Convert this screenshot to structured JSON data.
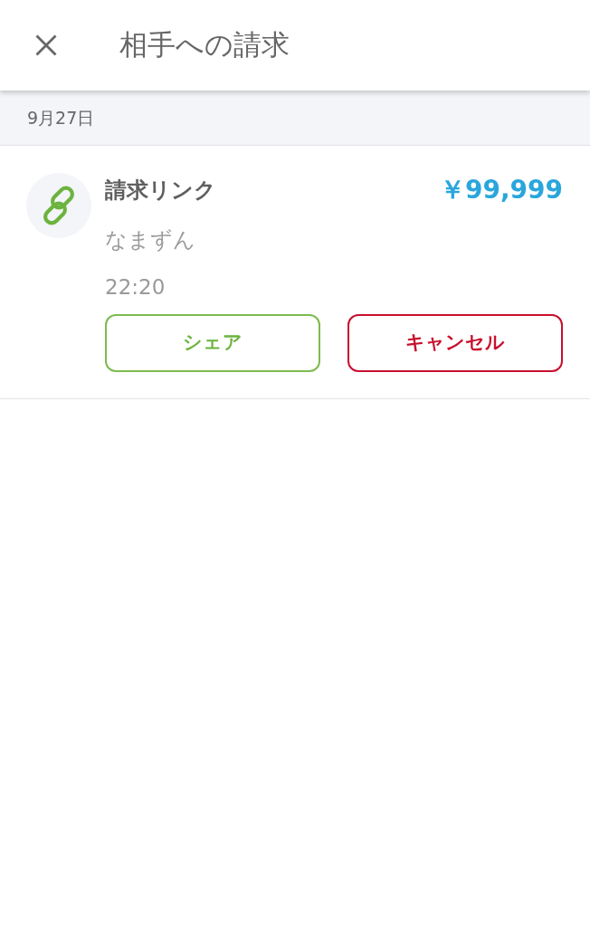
{
  "header": {
    "title": "相手への請求"
  },
  "groups": [
    {
      "date": "9月27日",
      "items": [
        {
          "kind": "link",
          "title": "請求リンク",
          "amount": "￥99,999",
          "name": "なまずん",
          "time": "22:20",
          "actions": [
            {
              "kind": "share",
              "label": "シェア"
            },
            {
              "kind": "cancel",
              "label": "キャンセル"
            }
          ]
        }
      ]
    }
  ]
}
